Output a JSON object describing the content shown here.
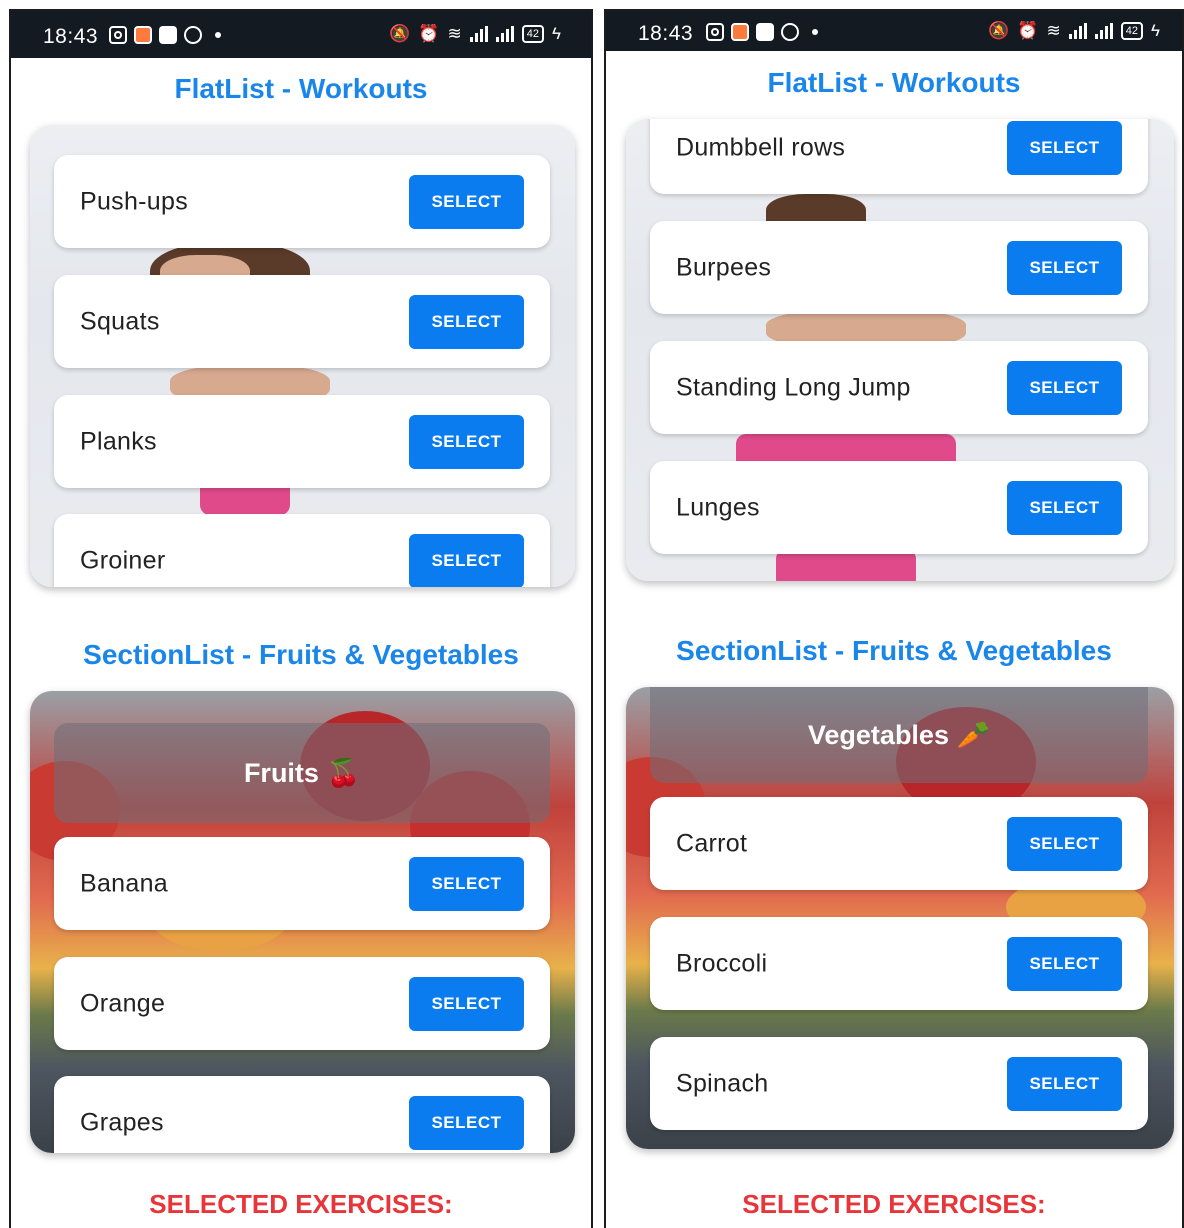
{
  "status": {
    "time": "18:43",
    "battery": "42"
  },
  "screens": [
    {
      "title": "FlatList - Workouts",
      "workouts": [
        {
          "label": "Push-ups",
          "button": "SELECT"
        },
        {
          "label": "Squats",
          "button": "SELECT"
        },
        {
          "label": "Planks",
          "button": "SELECT"
        },
        {
          "label": "Groiner",
          "button": "SELECT"
        }
      ],
      "section_title": "SectionList - Fruits & Vegetables",
      "section_header": "Fruits 🍒",
      "items": [
        {
          "label": "Banana",
          "button": "SELECT"
        },
        {
          "label": "Orange",
          "button": "SELECT"
        },
        {
          "label": "Grapes",
          "button": "SELECT"
        }
      ],
      "selected_title": "SELECTED EXERCISES:"
    },
    {
      "title": "FlatList - Workouts",
      "workouts": [
        {
          "label": "Dumbbell rows",
          "button": "SELECT"
        },
        {
          "label": "Burpees",
          "button": "SELECT"
        },
        {
          "label": "Standing Long Jump",
          "button": "SELECT"
        },
        {
          "label": "Lunges",
          "button": "SELECT"
        }
      ],
      "section_title": "SectionList - Fruits & Vegetables",
      "section_header": "Vegetables 🥕",
      "items": [
        {
          "label": "Carrot",
          "button": "SELECT"
        },
        {
          "label": "Broccoli",
          "button": "SELECT"
        },
        {
          "label": "Spinach",
          "button": "SELECT"
        }
      ],
      "selected_title": "SELECTED EXERCISES:"
    }
  ]
}
